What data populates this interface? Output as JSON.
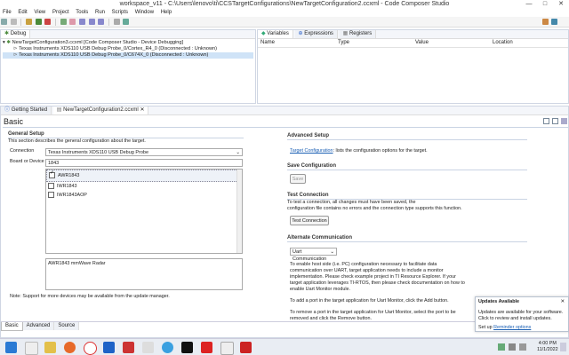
{
  "window": {
    "title": "workspace_v11 - C:\\Users\\lenovo\\ti\\CCSTargetConfigurations\\NewTargetConfiguration2.ccxml - Code Composer Studio"
  },
  "menu": [
    "File",
    "Edit",
    "View",
    "Project",
    "Tools",
    "Run",
    "Scripts",
    "Window",
    "Help"
  ],
  "debug_view": {
    "tab_label": "Debug",
    "root": "NewTargetConfiguration3.ccxml [Code Composer Studio - Device Debugging]",
    "items": [
      "Texas Instruments XDS110 USB Debug Probe_0/Cortex_R4_0 (Disconnected : Unknown)",
      "Texas Instruments XDS110 USB Debug Probe_0/C674X_0 (Disconnected : Unknown)"
    ]
  },
  "variables_view": {
    "tabs": [
      "Variables",
      "Expressions",
      "Registers"
    ],
    "columns": [
      "Name",
      "Type",
      "Value",
      "Location"
    ]
  },
  "editor": {
    "tabs": [
      "Getting Started",
      "NewTargetConfiguration2.ccxml"
    ],
    "heading": "Basic",
    "bottom_tabs": [
      "Basic",
      "Advanced",
      "Source"
    ]
  },
  "general_setup": {
    "title": "General Setup",
    "description": "This section describes the general configuration about the target.",
    "connection_label": "Connection",
    "connection_value": "Texas Instruments XDS110 USB Debug Probe",
    "board_label": "Board or Device",
    "board_value": "1843",
    "devices": [
      {
        "name": "AWR1843",
        "checked": true
      },
      {
        "name": "IWR1843",
        "checked": false
      },
      {
        "name": "IWR1843AOP",
        "checked": false
      }
    ],
    "device_description": "AWR1843 mmWave Radar",
    "note": "Note: Support for more devices may be available from the update manager."
  },
  "advanced_setup": {
    "title": "Advanced Setup",
    "link": "Target Configuration",
    "link_suffix": ": lists the configuration options for the target."
  },
  "save_config": {
    "title": "Save Configuration",
    "button": "Save"
  },
  "test_connection": {
    "title": "Test Connection",
    "line1": "To test a connection, all changes must have been saved, the",
    "line2": "configuration file contains no errors and the connection type supports this function.",
    "button": "Test Connection"
  },
  "alt_comm": {
    "title": "Alternate Communication",
    "select": "Uart Communication",
    "para1": [
      "To enable host side (i.e. PC) configuration necessary to facilitate data",
      "communication over UART, target application needs to include a monitor",
      "implementation. Please check example project in TI Resource Explorer. If your",
      "target application leverages TI-RTOS, then please check documentation on how to",
      "enable Uart Monitor module."
    ],
    "para2": "To add a port in the target application for Uart Monitor, click the Add button.",
    "para3": [
      "To remove a port in the target application for Uart Monitor, select the port to be",
      "removed and click the Remove button."
    ]
  },
  "updates_popup": {
    "title": "Updates Available",
    "line1": "Updates are available for your software.",
    "line2": "Click to review and install updates.",
    "setup_prefix": "Set up",
    "setup_link": "Reminder options"
  },
  "taskbar": {
    "time": "4:00 PM",
    "date": "11/1/2022"
  },
  "colors": {
    "accent": "#1a5fb4",
    "selection": "#cfe3f7",
    "panel_border": "#cfd6e3"
  }
}
